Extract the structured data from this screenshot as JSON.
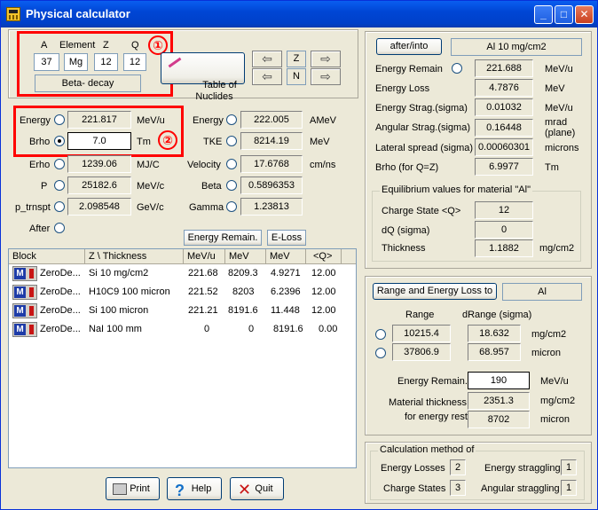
{
  "window": {
    "title": "Physical calculator"
  },
  "titlebar_buttons": {
    "minimize": "_",
    "maximize": "□",
    "close": "✕"
  },
  "nuclide": {
    "label_a": "A",
    "label_element": "Element",
    "label_z": "Z",
    "label_q": "Q",
    "a": "37",
    "element": "Mg",
    "z": "12",
    "q": "12",
    "decay": "Beta- decay",
    "table_btn": "Table of\nNuclides",
    "z_label": "Z",
    "n_label": "N"
  },
  "annotations": {
    "one": "①",
    "two": "②"
  },
  "kinematics": {
    "energy_label": "Energy",
    "energy_value": "221.817",
    "energy_unit": "MeV/u",
    "brho_label": "Brho",
    "brho_value": "7.0",
    "brho_unit": "Tm",
    "erho_label": "Erho",
    "erho_value": "1239.06",
    "erho_unit": "MJ/C",
    "p_label": "P",
    "p_value": "25182.6",
    "p_unit": "MeV/c",
    "ptrnspt_label": "p_trnspt",
    "ptrnspt_value": "2.098548",
    "ptrnspt_unit": "GeV/c",
    "after_label": "After",
    "energy2_label": "Energy",
    "energy2_value": "222.005",
    "energy2_unit": "AMeV",
    "tke_label": "TKE",
    "tke_value": "8214.19",
    "tke_unit": "MeV",
    "velocity_label": "Velocity",
    "velocity_value": "17.6768",
    "velocity_unit": "cm/ns",
    "beta_label": "Beta",
    "beta_value": "0.5896353",
    "gamma_label": "Gamma",
    "gamma_value": "1.23813"
  },
  "tabs": {
    "energy_remain": "Energy Remain.",
    "eloss": "E-Loss"
  },
  "table": {
    "headers": [
      "Block",
      "Z \\ Thickness",
      "MeV/u",
      "MeV",
      "MeV",
      "<Q>"
    ],
    "rows": [
      {
        "block": "ZeroDe...",
        "thickness": "Si 10 mg/cm2",
        "mevu": "221.68",
        "mev": "8209.3",
        "mev2": "4.9271",
        "q": "12.00"
      },
      {
        "block": "ZeroDe...",
        "thickness": "H10C9 100 micron",
        "mevu": "221.52",
        "mev": "8203",
        "mev2": "6.2396",
        "q": "12.00"
      },
      {
        "block": "ZeroDe...",
        "thickness": "Si 100 micron",
        "mevu": "221.21",
        "mev": "8191.6",
        "mev2": "11.448",
        "q": "12.00"
      },
      {
        "block": "ZeroDe...",
        "thickness": "NaI 100 mm",
        "mevu": "0",
        "mev": "0",
        "mev2": "8191.6",
        "q": "0.00"
      }
    ]
  },
  "bottom_buttons": {
    "print": "Print",
    "help": "Help",
    "quit": "Quit"
  },
  "after_into": {
    "button": "after/into",
    "material": "Al 10 mg/cm2",
    "energy_remain_label": "Energy Remain",
    "energy_remain_value": "221.688",
    "energy_remain_unit": "MeV/u",
    "energy_loss_label": "Energy Loss",
    "energy_loss_value": "4.7876",
    "energy_loss_unit": "MeV",
    "energy_strag_label": "Energy Strag.(sigma)",
    "energy_strag_value": "0.01032",
    "energy_strag_unit": "MeV/u",
    "angular_strag_label": "Angular Strag.(sigma)",
    "angular_strag_value": "0.16448",
    "angular_strag_unit": "mrad\n(plane)",
    "lateral_label": "Lateral spread (sigma)",
    "lateral_value": "0.00060301",
    "lateral_unit": "microns",
    "brho_label": "Brho (for Q=Z)",
    "brho_value": "6.9977",
    "brho_unit": "Tm",
    "equilibrium_caption": "Equilibrium values for material \"Al\"",
    "charge_state_label": "Charge State <Q>",
    "charge_state_value": "12",
    "dq_label": "dQ (sigma)",
    "dq_value": "0",
    "thickness_label": "Thickness",
    "thickness_value": "1.1882",
    "thickness_unit": "mg/cm2"
  },
  "range": {
    "button": "Range and Energy Loss to",
    "material": "Al",
    "range_header": "Range",
    "drange_header": "dRange (sigma)",
    "range1": "10215.4",
    "drange1": "18.632",
    "unit1": "mg/cm2",
    "range2": "37806.9",
    "drange2": "68.957",
    "unit2": "micron",
    "energy_remain_label": "Energy Remain.",
    "energy_remain_value": "190",
    "energy_remain_unit": "MeV/u",
    "material_thickness_label": "Material thickness",
    "material_thickness_label2": "for energy rest",
    "material_thickness_value": "2351.3",
    "material_thickness_unit": "mg/cm2",
    "micron_value": "8702",
    "micron_unit": "micron"
  },
  "calc_method": {
    "caption": "Calculation method of",
    "energy_losses_label": "Energy Losses",
    "energy_losses_value": "2",
    "energy_straggling_label": "Energy straggling",
    "energy_straggling_value": "1",
    "charge_states_label": "Charge States",
    "charge_states_value": "3",
    "angular_straggling_label": "Angular straggling",
    "angular_straggling_value": "1"
  }
}
